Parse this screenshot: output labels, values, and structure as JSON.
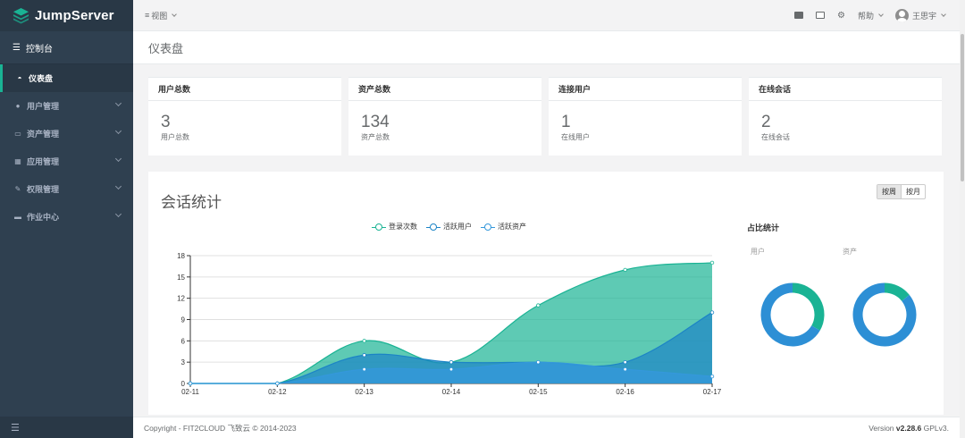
{
  "brand": {
    "name": "JumpServer"
  },
  "sidebar": {
    "console": "控制台",
    "items": [
      {
        "label": "仪表盘",
        "icon": "dashboard-icon",
        "active": true
      },
      {
        "label": "用户管理",
        "icon": "users-icon",
        "has_children": true
      },
      {
        "label": "资产管理",
        "icon": "inbox-icon",
        "has_children": true
      },
      {
        "label": "应用管理",
        "icon": "grid-icon",
        "has_children": true
      },
      {
        "label": "权限管理",
        "icon": "edit-icon",
        "has_children": true
      },
      {
        "label": "作业中心",
        "icon": "terminal-icon",
        "has_children": true
      }
    ]
  },
  "topbar": {
    "view_label": "视图",
    "help_label": "帮助",
    "user_name": "王思宇"
  },
  "page": {
    "title": "仪表盘"
  },
  "stats": [
    {
      "title": "用户总数",
      "value": "3",
      "sub": "用户总数"
    },
    {
      "title": "资产总数",
      "value": "134",
      "sub": "资产总数"
    },
    {
      "title": "连接用户",
      "value": "1",
      "sub": "在线用户"
    },
    {
      "title": "在线会话",
      "value": "2",
      "sub": "在线会话"
    }
  ],
  "session_panel": {
    "title": "会话统计",
    "btn_week": "按周",
    "btn_month": "按月",
    "ratio_title": "占比统计",
    "ratio_user": "用户",
    "ratio_asset": "资产"
  },
  "chart_data": {
    "type": "area",
    "categories": [
      "02-11",
      "02-12",
      "02-13",
      "02-14",
      "02-15",
      "02-16",
      "02-17"
    ],
    "ylim": [
      0,
      18
    ],
    "yticks": [
      0,
      3,
      6,
      9,
      12,
      15,
      18
    ],
    "series": [
      {
        "name": "登录次数",
        "color": "#1ab394",
        "values": [
          0,
          0,
          6,
          3,
          11,
          16,
          17
        ]
      },
      {
        "name": "活跃用户",
        "color": "#1c84c6",
        "values": [
          0,
          0,
          4,
          3,
          3,
          3,
          10
        ]
      },
      {
        "name": "活跃资产",
        "color": "#3498db",
        "values": [
          0,
          0,
          2,
          2,
          3,
          2,
          1
        ]
      }
    ],
    "donuts": [
      {
        "label": "用户",
        "segments": [
          {
            "value": 1,
            "color": "#1ab394"
          },
          {
            "value": 2,
            "color": "#2d8fd5"
          }
        ]
      },
      {
        "label": "资产",
        "segments": [
          {
            "value": 1,
            "color": "#1ab394"
          },
          {
            "value": 6,
            "color": "#2d8fd5"
          }
        ]
      }
    ]
  },
  "footer": {
    "copyright": "Copyright - FIT2CLOUD 飞致云 © 2014-2023",
    "version_prefix": "Version ",
    "version": "v2.28.6",
    "license": " GPLv3."
  }
}
